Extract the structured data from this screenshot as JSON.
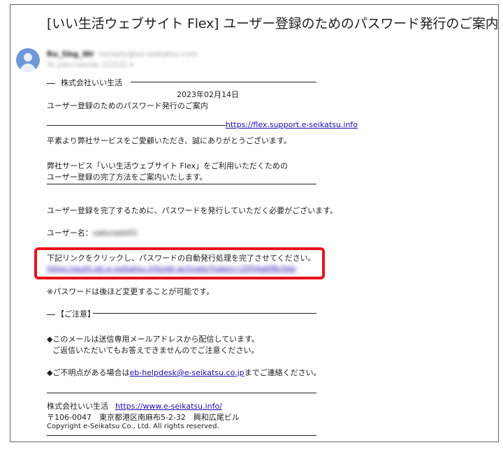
{
  "email": {
    "subject": "[いい生活ウェブサイト Flex] ユーザー登録のためのパスワード発行のご案内",
    "sender_name": "Ro_Sbg_Wr",
    "sender_email": "noreply@ee-seikatsu.com",
    "to_line": "To yoko.takeda 222222 ▾"
  },
  "body": {
    "company_header": "株式会社いい生活",
    "date": "2023年02月14日",
    "title": "ユーザー登録のためのパスワード発行のご案内",
    "support_link": "https://flex.support.e-seikatsu.info",
    "greeting": "平素より弊社サービスをご愛顧いただき、誠にありがとうございます。",
    "intro_1": "弊社サービス「いい生活ウェブサイト Flex」をご利用いただくための",
    "intro_2": "ユーザー登録の完了方法をご案内いたします。",
    "need_password": "ユーザー登録を完了するために、パスワードを発行していただく必要がございます。",
    "username_label": "ユーザー名：",
    "username_value": "sakurado01",
    "click_instruction": "下記リンクをクリックし、パスワードの自動発行処理を完了させてください。",
    "activation_link": "https://auth.eb.e-seikatsu.info/eb-activate?token=2054a6f8c0de",
    "password_note": "※パスワードは後ほど変更することが可能です。",
    "notice_header": "【ご注意】",
    "notice_1a": "◆このメールは送信専用メールアドレスから配信しています。",
    "notice_1b": "ご返信いただいてもお答えできませんのでご注意ください。",
    "notice_2_prefix": "◆ご不明点がある場合は",
    "helpdesk_email": "eb-helpdesk@e-seikatsu.co.jp",
    "notice_2_suffix": "までご連絡ください。",
    "footer_company": "株式会社いい生活",
    "footer_url": "https://www.e-seikatsu.info/",
    "footer_address": "〒106-0047　東京都港区南麻布5-2-32　興和広尾ビル",
    "footer_copyright": "Copyright  e-Seikatsu Co., Ltd. All rights reserved."
  },
  "colors": {
    "link": "#1a0dab",
    "highlight": "#e8141b",
    "avatar": "#6e98d8"
  }
}
